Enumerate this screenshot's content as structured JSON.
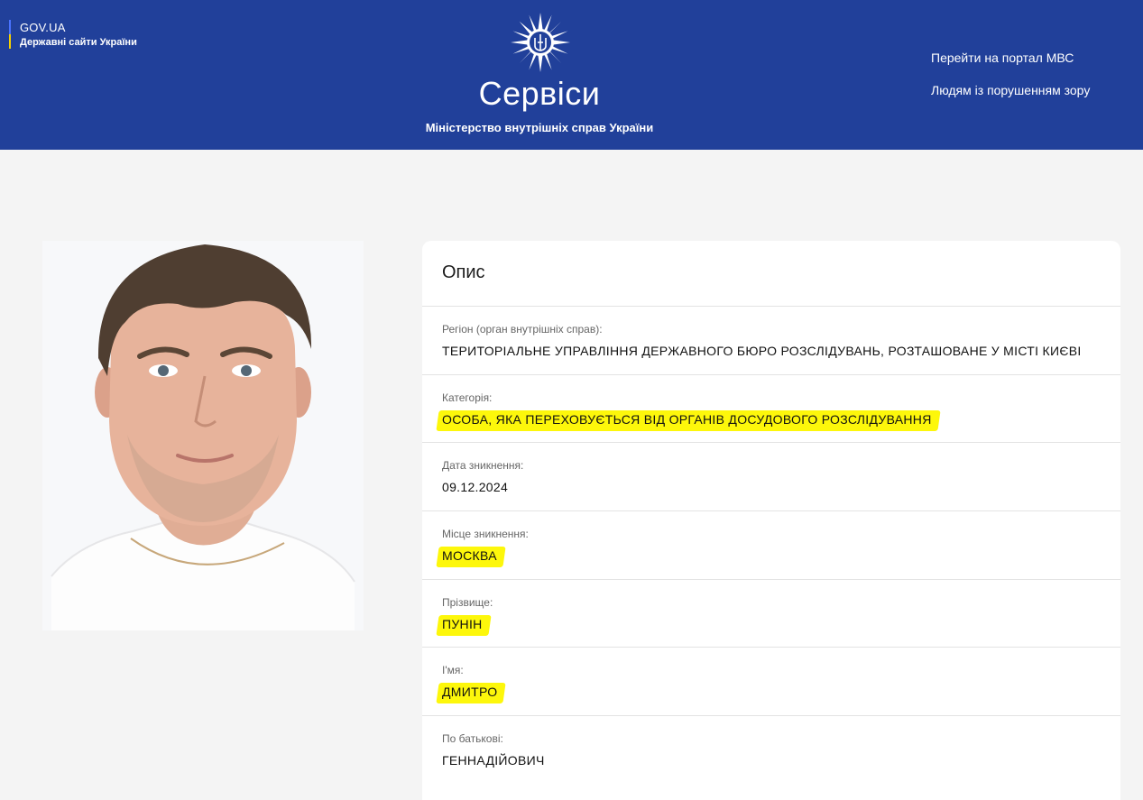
{
  "header": {
    "gov_title": "GOV.UA",
    "gov_subtitle": "Державні сайти України",
    "brand_title": "Сервіси",
    "brand_subtitle": "Міністерство внутрішніх справ України",
    "links": [
      "Перейти на портал МВС",
      "Людям із порушенням зору"
    ],
    "colors": {
      "header_bg": "#21409a",
      "highlight": "#fdf70b"
    }
  },
  "photo": {
    "icon": "person-photo"
  },
  "card": {
    "title": "Опис",
    "fields": [
      {
        "label": "Регіон (орган внутрішніх справ):",
        "value": "ТЕРИТОРІАЛЬНЕ УПРАВЛІННЯ ДЕРЖАВНОГО БЮРО РОЗСЛІДУВАНЬ, РОЗТАШОВАНЕ У МІСТІ КИЄВІ",
        "highlighted": false
      },
      {
        "label": "Категорія:",
        "value": "ОСОБА, ЯКА ПЕРЕХОВУЄТЬСЯ ВІД ОРГАНІВ ДОСУДОВОГО РОЗСЛІДУВАННЯ",
        "highlighted": true
      },
      {
        "label": "Дата зникнення:",
        "value": "09.12.2024",
        "highlighted": false
      },
      {
        "label": "Місце зникнення:",
        "value": "МОСКВА",
        "highlighted": true
      },
      {
        "label": "Прізвище:",
        "value": "ПУНІН",
        "highlighted": true
      },
      {
        "label": "І'мя:",
        "value": "ДМИТРО",
        "highlighted": true
      },
      {
        "label": "По батькові:",
        "value": "ГЕННАДІЙОВИЧ",
        "highlighted": false
      }
    ]
  }
}
